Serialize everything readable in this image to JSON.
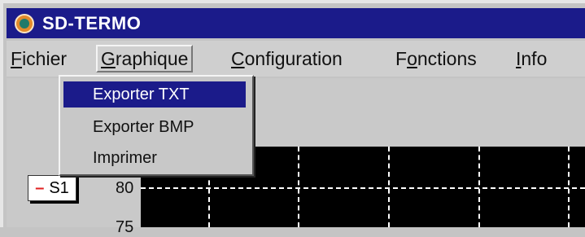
{
  "window": {
    "title": "SD-TERMO",
    "icon": "app-thermo-icon"
  },
  "menubar": {
    "items": [
      {
        "pre": "",
        "acc": "F",
        "post": "ichier"
      },
      {
        "pre": "",
        "acc": "G",
        "post": "raphique"
      },
      {
        "pre": "",
        "acc": "C",
        "post": "onfiguration"
      },
      {
        "pre": "F",
        "acc": "o",
        "post": "nctions"
      },
      {
        "pre": "",
        "acc": "I",
        "post": "nfo"
      }
    ]
  },
  "dropdown": {
    "items": [
      "Exporter TXT",
      "Exporter BMP",
      "Imprimer"
    ],
    "selected_index": 0
  },
  "chart": {
    "legend": {
      "label": "S1",
      "color": "#e02020"
    },
    "y_ticks": [
      "80",
      "75"
    ]
  }
}
